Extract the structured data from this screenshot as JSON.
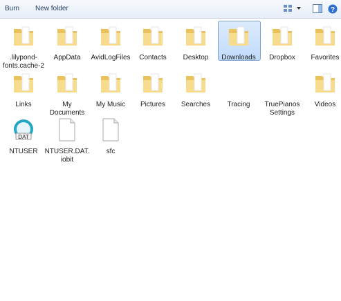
{
  "toolbar": {
    "burn_label": "Burn",
    "new_folder_label": "New folder"
  },
  "items": [
    {
      "label": ".lilypond-fonts.cache-2",
      "icon": "folder-icon"
    },
    {
      "label": "AppData",
      "icon": "folder-icon"
    },
    {
      "label": "AvidLogFiles",
      "icon": "folder-icon"
    },
    {
      "label": "Contacts",
      "icon": "folder-icon"
    },
    {
      "label": "Desktop",
      "icon": "folder-icon"
    },
    {
      "label": "Downloads",
      "icon": "folder-icon",
      "selected": true
    },
    {
      "label": "Dropbox",
      "icon": "folder-icon"
    },
    {
      "label": "Favorites",
      "icon": "folder-icon"
    },
    {
      "label": "Links",
      "icon": "folder-icon"
    },
    {
      "label": "My Documents",
      "icon": "folder-icon"
    },
    {
      "label": "My Music",
      "icon": "folder-icon"
    },
    {
      "label": "Pictures",
      "icon": "folder-icon"
    },
    {
      "label": "Searches",
      "icon": "folder-icon"
    },
    {
      "label": "Tracing",
      "icon": "folder-icon"
    },
    {
      "label": "TruePianos Settings",
      "icon": "folder-icon"
    },
    {
      "label": "Videos",
      "icon": "folder-icon"
    },
    {
      "label": "NTUSER",
      "icon": "dat-file-icon",
      "icon_text": "DAT"
    },
    {
      "label": "NTUSER.DAT.iobit",
      "icon": "blank-file-icon"
    },
    {
      "label": "sfc",
      "icon": "blank-file-icon"
    }
  ],
  "colors": {
    "folder": "#f3d27a",
    "selection": "#cce4fc",
    "toolbar_text": "#1e395b"
  }
}
